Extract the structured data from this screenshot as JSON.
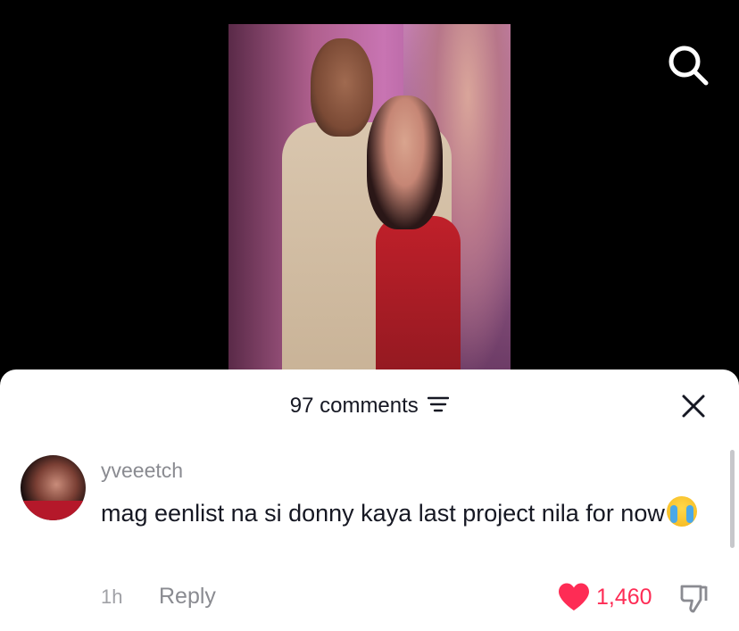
{
  "video": {
    "search_icon": "search-icon"
  },
  "comments_sheet": {
    "count_label": "97 comments",
    "sort_icon": "filter-sort-icon",
    "close_icon": "close-icon"
  },
  "comment": {
    "username": "yveeetch",
    "text": "mag eenlist na si donny kaya last project nila for now",
    "emoji": "😭",
    "time": "1h",
    "reply_label": "Reply",
    "likes": "1,460",
    "like_color": "#fe2c55"
  }
}
